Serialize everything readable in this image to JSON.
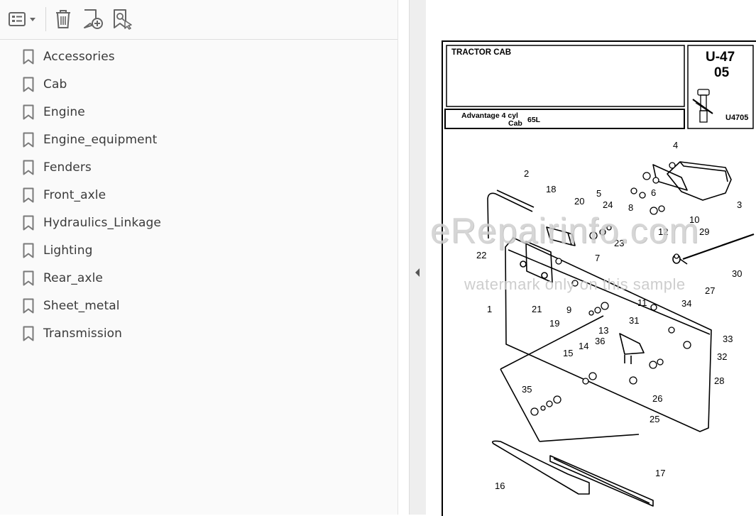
{
  "toolbar": {
    "options_icon": "bookmark-options-icon",
    "delete_icon": "trash-icon",
    "add_bookmark_icon": "add-bookmark-icon",
    "find_bookmark_icon": "find-current-bookmark-icon"
  },
  "bookmarks": [
    {
      "label": "Accessories"
    },
    {
      "label": "Cab"
    },
    {
      "label": "Engine"
    },
    {
      "label": "Engine_equipment"
    },
    {
      "label": "Fenders"
    },
    {
      "label": "Front_axle"
    },
    {
      "label": "Hydraulics_Linkage"
    },
    {
      "label": "Lighting"
    },
    {
      "label": "Rear_axle"
    },
    {
      "label": "Sheet_metal"
    },
    {
      "label": "Transmission"
    }
  ],
  "document": {
    "section_title": "TRACTOR CAB",
    "page_code": "U-47",
    "page_sub": "05",
    "model_line1": "Advantage 4 cyl",
    "model_line2": "Cab",
    "model_hp": "65L",
    "ref_code": "U4705",
    "watermark": "eRepairinfo.com",
    "watermark_sub": "watermark only on this sample",
    "callouts": [
      "1",
      "2",
      "3",
      "4",
      "5",
      "6",
      "7",
      "8",
      "9",
      "10",
      "11",
      "12",
      "13",
      "14",
      "15",
      "16",
      "17",
      "18",
      "19",
      "20",
      "21",
      "22",
      "23",
      "24",
      "25",
      "26",
      "27",
      "28",
      "29",
      "30",
      "31",
      "32",
      "33",
      "34",
      "35",
      "36"
    ]
  },
  "colors": {
    "panel_bg": "#fafafa",
    "text": "#3a3a3a",
    "icon": "#7a7a7a",
    "splitter": "#eeeeee"
  }
}
